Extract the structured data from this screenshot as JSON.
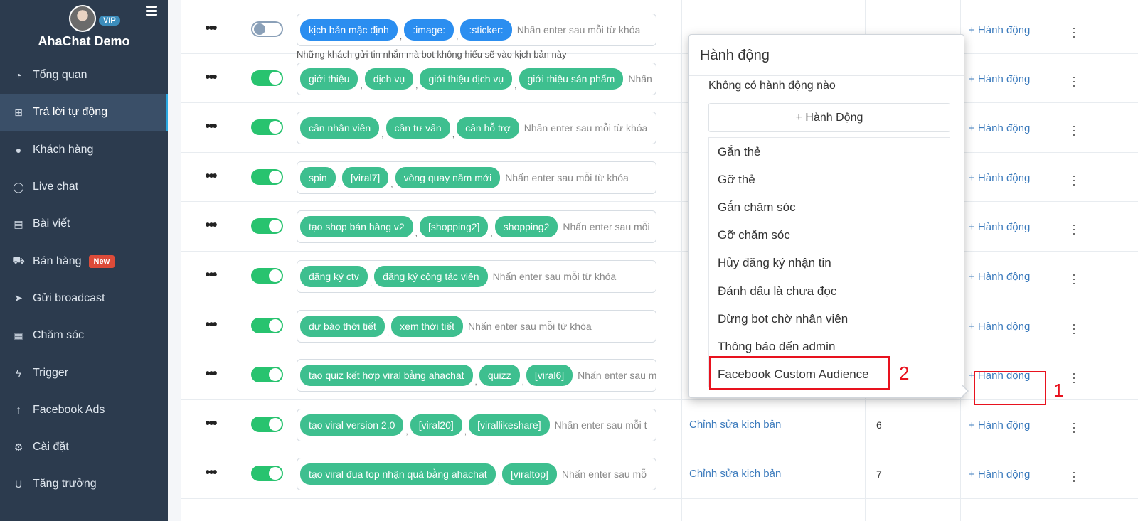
{
  "sidebar": {
    "brand": "AhaChat Demo",
    "vip": "VIP",
    "items": [
      {
        "label": "Tổng quan",
        "icon": "dashboard-icon"
      },
      {
        "label": "Trả lời tự động",
        "icon": "sitemap-icon",
        "active": true
      },
      {
        "label": "Khách hàng",
        "icon": "user-icon"
      },
      {
        "label": "Live chat",
        "icon": "chat-icon"
      },
      {
        "label": "Bài viết",
        "icon": "book-icon"
      },
      {
        "label": "Bán hàng",
        "icon": "cart-icon",
        "badge": "New"
      },
      {
        "label": "Gửi broadcast",
        "icon": "paper-plane-icon"
      },
      {
        "label": "Chăm sóc",
        "icon": "calendar-icon"
      },
      {
        "label": "Trigger",
        "icon": "bolt-icon"
      },
      {
        "label": "Facebook Ads",
        "icon": "facebook-icon"
      },
      {
        "label": "Cài đặt",
        "icon": "gear-icon"
      },
      {
        "label": "Tăng trưởng",
        "icon": "magnet-icon"
      }
    ]
  },
  "table": {
    "placeholder": "Nhấn enter sau mỗi từ khóa",
    "edit_label": "Chỉnh sửa kịch bản",
    "action_label": "+ Hành động",
    "rows": [
      {
        "enabled": false,
        "tags": [
          {
            "text": "kịch bản mặc định",
            "blue": true
          },
          {
            "text": ":image:",
            "blue": true
          },
          {
            "text": ":sticker:",
            "blue": true
          }
        ],
        "hint": "Những khách gửi tin nhắn mà bot không hiểu sẽ vào kịch bản này",
        "placeholder": "Nhấn enter sau mỗi từ khóa"
      },
      {
        "enabled": true,
        "tags": [
          {
            "text": "giới thiệu"
          },
          {
            "text": "dịch vụ"
          },
          {
            "text": "giới thiệu dịch vụ"
          },
          {
            "text": "giới thiệu sản phẩm"
          }
        ],
        "placeholder": "Nhấn"
      },
      {
        "enabled": true,
        "tags": [
          {
            "text": "cần nhân viên"
          },
          {
            "text": "cần tư vấn"
          },
          {
            "text": "cần hỗ trợ"
          }
        ],
        "placeholder": "Nhấn enter sau mỗi từ khóa"
      },
      {
        "enabled": true,
        "tags": [
          {
            "text": "spin"
          },
          {
            "text": "[viral7]"
          },
          {
            "text": "vòng quay năm mới"
          }
        ],
        "placeholder": "Nhấn enter sau mỗi từ khóa"
      },
      {
        "enabled": true,
        "tags": [
          {
            "text": "tạo shop bán hàng v2"
          },
          {
            "text": "[shopping2]"
          },
          {
            "text": "shopping2"
          }
        ],
        "placeholder": "Nhấn enter sau mỗi"
      },
      {
        "enabled": true,
        "tags": [
          {
            "text": "đăng ký ctv"
          },
          {
            "text": "đăng ký cộng tác viên"
          }
        ],
        "placeholder": "Nhấn enter sau mỗi từ khóa"
      },
      {
        "enabled": true,
        "tags": [
          {
            "text": "dự báo thời tiết"
          },
          {
            "text": "xem thời tiết"
          }
        ],
        "placeholder": "Nhấn enter sau mỗi từ khóa"
      },
      {
        "enabled": true,
        "tags": [
          {
            "text": "tạo quiz kết hợp viral bằng ahachat"
          },
          {
            "text": "quizz"
          },
          {
            "text": "[viral6]"
          }
        ],
        "placeholder": "Nhấn enter sau mỗi"
      },
      {
        "enabled": true,
        "tags": [
          {
            "text": "tạo viral version 2.0"
          },
          {
            "text": "[viral20]"
          },
          {
            "text": "[virallikeshare]"
          }
        ],
        "placeholder": "Nhấn enter sau mỗi t",
        "edit": true,
        "count": "6"
      },
      {
        "enabled": true,
        "tags": [
          {
            "text": "tạo viral đua top nhận quà bằng ahachat"
          },
          {
            "text": "[viraltop]"
          }
        ],
        "placeholder": "Nhấn enter sau mỗ",
        "edit": true,
        "count": "7"
      }
    ]
  },
  "popover": {
    "title": "Hành động",
    "empty_text": "Không có hành động nào",
    "add_button": "+ Hành Động",
    "items": [
      "Gắn thẻ",
      "Gỡ thẻ",
      "Gắn chăm sóc",
      "Gỡ chăm sóc",
      "Hủy đăng ký nhận tin",
      "Đánh dấu là chưa đọc",
      "Dừng bot chờ nhân viên",
      "Thông báo đến admin",
      "Facebook Custom Audience"
    ]
  },
  "annotations": {
    "step1": "1",
    "step2": "2"
  },
  "colors": {
    "sidebar_bg": "#2c3b4e",
    "tag_green": "#3ebf8f",
    "tag_blue": "#2b8ef0",
    "link_blue": "#3c7bbd",
    "highlight_red": "#e8121e"
  }
}
